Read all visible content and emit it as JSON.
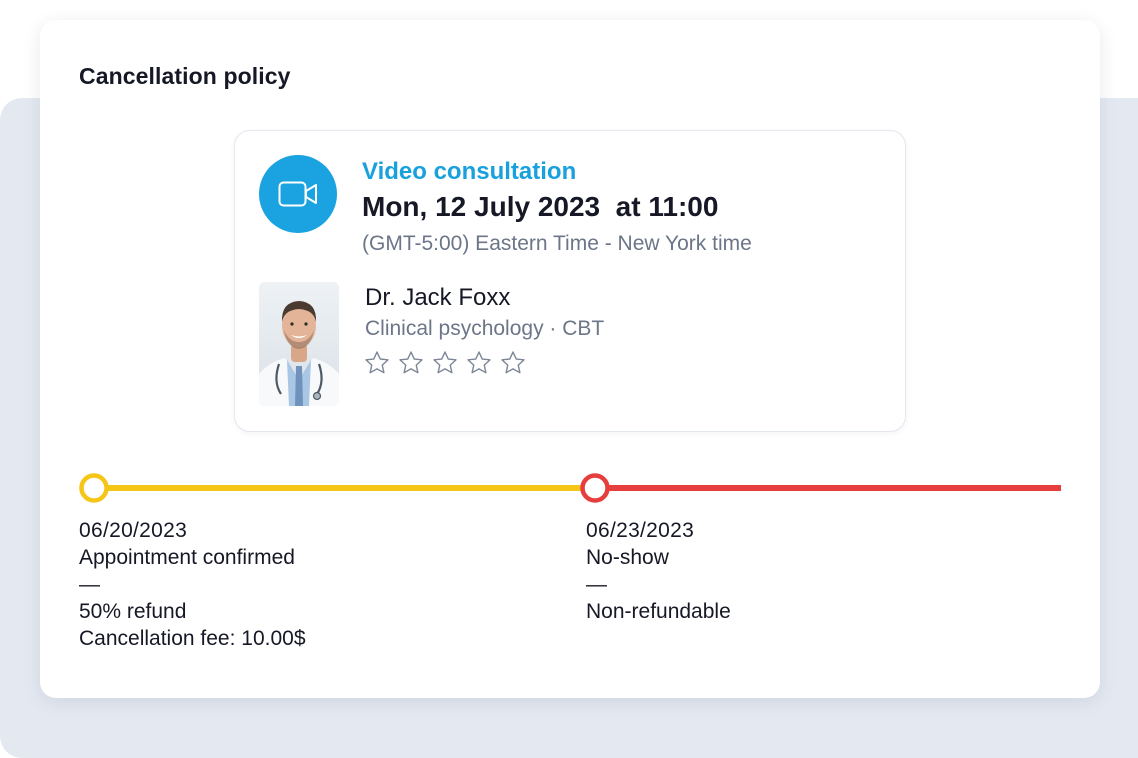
{
  "policy": {
    "title": "Cancellation policy"
  },
  "appointment": {
    "type": "Video consultation",
    "datetime": "Mon, 12 July 2023  at 11:00",
    "timezone": "(GMT-5:00) Eastern Time - New York time",
    "icon": "video-camera-icon",
    "accent_color": "#1aa3e0"
  },
  "doctor": {
    "name": "Dr. Jack Foxx",
    "specialty": "Clinical psychology · CBT",
    "rating": {
      "value": 0,
      "max": 5
    }
  },
  "timeline": {
    "colors": {
      "refund_segment": "#f5c518",
      "nonrefund_segment": "#e63d3d"
    },
    "milestones": [
      {
        "date": "06/20/2023",
        "event": "Appointment confirmed",
        "separator": "—",
        "details": [
          "50% refund",
          "Cancellation fee: 10.00$"
        ]
      },
      {
        "date": "06/23/2023",
        "event": "No-show",
        "separator": "—",
        "details": [
          "Non-refundable"
        ]
      }
    ]
  }
}
